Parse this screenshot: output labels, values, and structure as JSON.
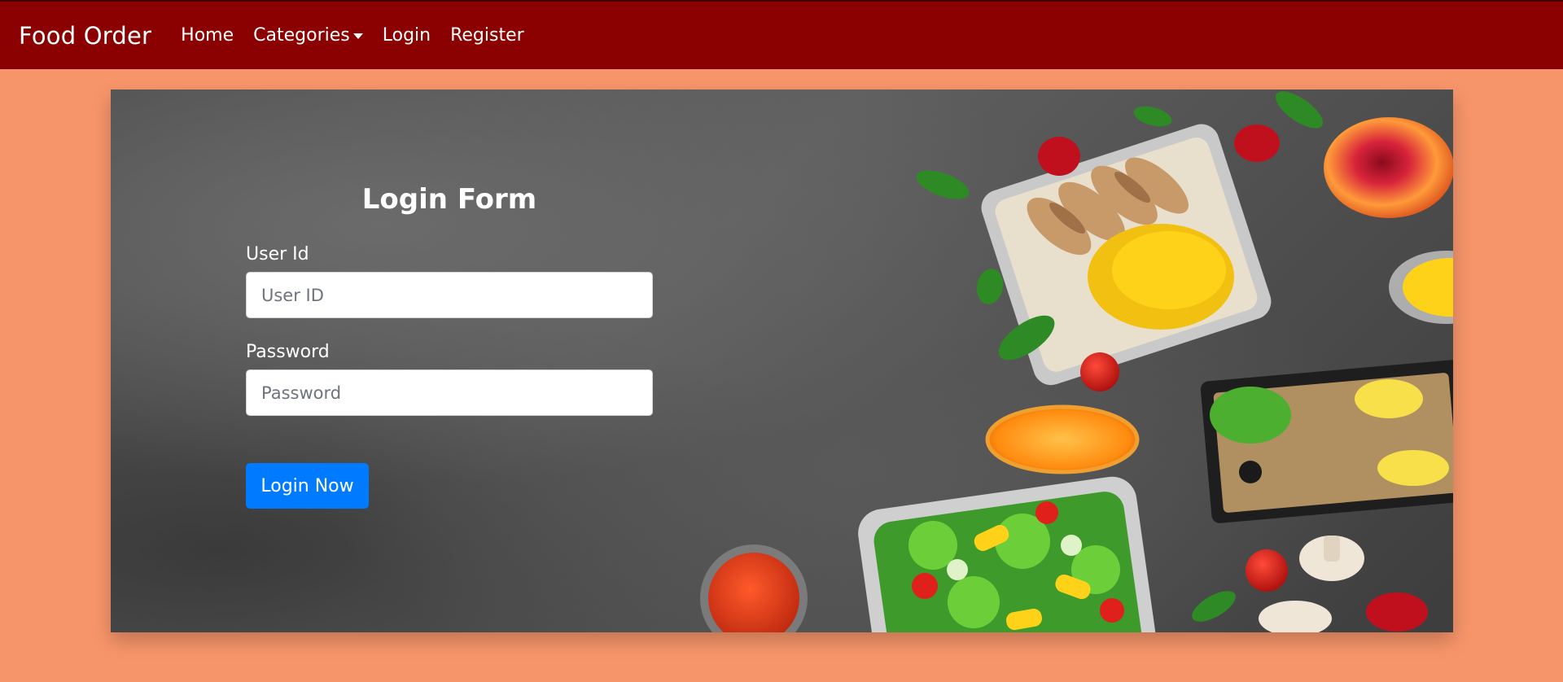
{
  "navbar": {
    "brand": "Food Order",
    "links": [
      {
        "label": "Home"
      },
      {
        "label": "Categories",
        "has_dropdown": true
      },
      {
        "label": "Login"
      },
      {
        "label": "Register"
      }
    ]
  },
  "login_form": {
    "title": "Login Form",
    "user_label": "User Id",
    "user_placeholder": "User ID",
    "user_value": "",
    "password_label": "Password",
    "password_placeholder": "Password",
    "password_value": "",
    "submit_label": "Login Now"
  },
  "colors": {
    "page_background": "#f7956a",
    "navbar_background": "#8b0000",
    "button_primary": "#007bff",
    "text_light": "#ffffff"
  },
  "icons": {
    "dropdown": "caret-down-icon"
  }
}
